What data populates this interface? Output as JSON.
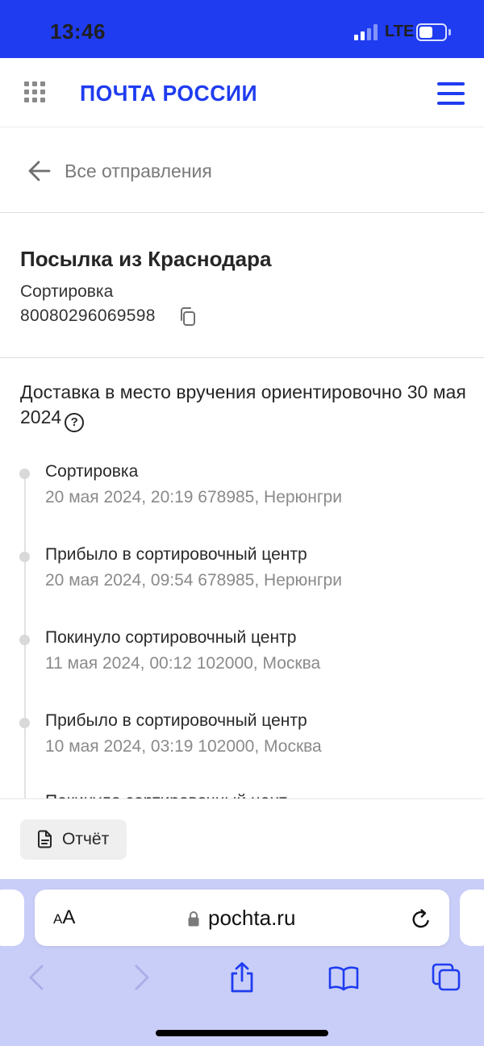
{
  "status_bar": {
    "time": "13:46",
    "network": "LTE"
  },
  "header": {
    "logo": "ПОЧТА РОССИИ"
  },
  "back_link": {
    "label": "Все отправления"
  },
  "parcel": {
    "title": "Посылка из Краснодара",
    "status": "Сортировка",
    "tracking_number": "80080296069598"
  },
  "delivery": {
    "text": "Доставка в место вручения ориентировочно 30 мая 2024",
    "help": "?"
  },
  "events": [
    {
      "title": "Сортировка",
      "detail": "20 мая 2024, 20:19 678985, Нерюнгри"
    },
    {
      "title": "Прибыло в сортировочный центр",
      "detail": "20 мая 2024, 09:54 678985, Нерюнгри"
    },
    {
      "title": "Покинуло сортировочный центр",
      "detail": "11 мая 2024, 00:12 102000, Москва"
    },
    {
      "title": "Прибыло в сортировочный центр",
      "detail": "10 мая 2024, 03:19 102000, Москва"
    }
  ],
  "clipped_event": {
    "title": "Покинуло сортировочный центр"
  },
  "report": {
    "label": "Отчёт"
  },
  "browser": {
    "text_size_small": "A",
    "text_size_large": "A",
    "url": "pochta.ru"
  },
  "colors": {
    "brand": "#1f3cf0",
    "browser_bar": "#c9cef8"
  }
}
